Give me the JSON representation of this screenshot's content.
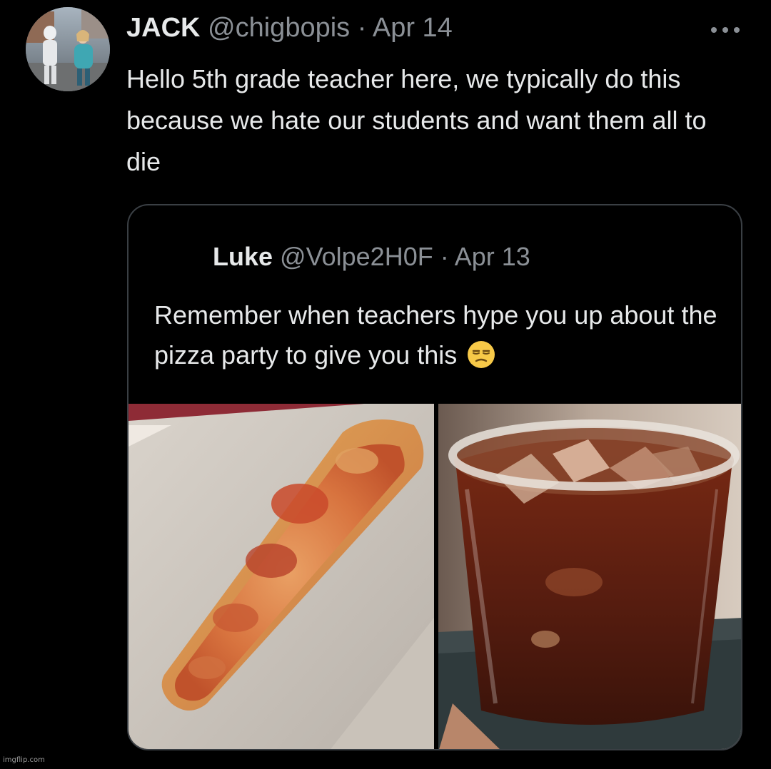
{
  "tweet": {
    "author_name": "JACK",
    "handle": "@chigbopis",
    "separator": "·",
    "date": "Apr 14",
    "text": "Hello 5th grade teacher here, we typically do this because we hate our students and want them all to die",
    "more_icon": "more-horizontal-icon"
  },
  "quoted_tweet": {
    "author_name": "Luke",
    "handle": "@Volpe2H0F",
    "separator": "·",
    "date": "Apr 13",
    "text": "Remember when teachers hype you up about the pizza party to give you this",
    "emoji": "unamused-face-emoji",
    "media": [
      {
        "subject": "pizza-slice-photo"
      },
      {
        "subject": "soda-cup-photo"
      }
    ]
  },
  "watermark": "imgflip.com",
  "colors": {
    "background": "#000000",
    "primary_text": "#e7e9ea",
    "secondary_text": "#8b9096",
    "card_border": "#3a3f44"
  }
}
